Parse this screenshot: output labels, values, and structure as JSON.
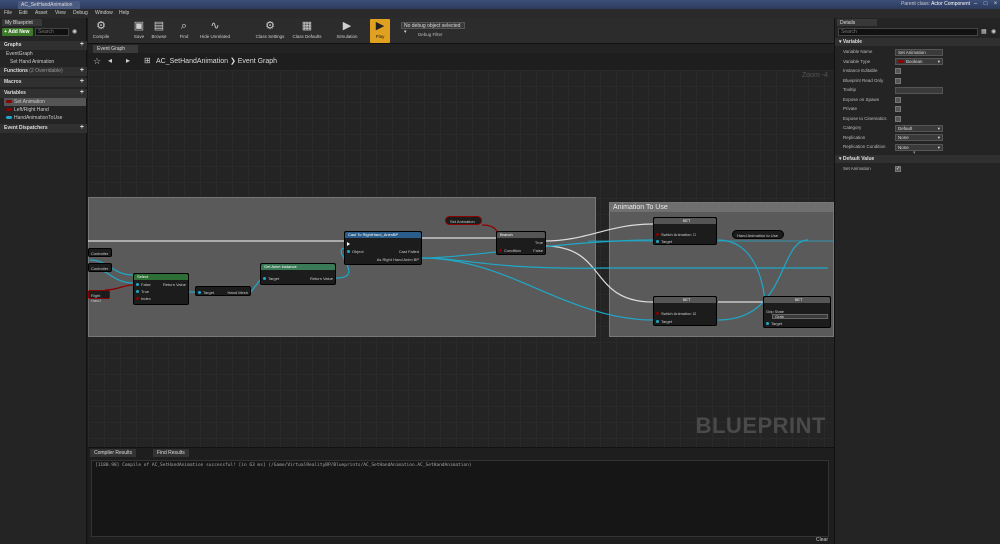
{
  "window": {
    "tab_title": "AC_SetHandAnimation",
    "top_right": "Parent class:",
    "parent_class": "Actor Component"
  },
  "menu": [
    "File",
    "Edit",
    "Asset",
    "View",
    "Debug",
    "Window",
    "Help"
  ],
  "left_panel": {
    "tab": "My Blueprint",
    "add_new": "+ Add New",
    "search_placeholder": "Search",
    "sections": {
      "graphs": "Graphs",
      "event_graph": "EventGraph",
      "event_item": "Set Hand Animation",
      "functions": "Functions",
      "functions_count": "(2 Overridable)",
      "macros": "Macros",
      "variables": "Variables",
      "dispatchers": "Event Dispatchers"
    },
    "variables": [
      {
        "name": "Set Animation",
        "color": "#8c0000"
      },
      {
        "name": "Left/Right Hand",
        "color": "#8c0000"
      },
      {
        "name": "HandAnimationToUse",
        "color": "#1fa8c8"
      }
    ]
  },
  "toolbar": {
    "buttons": [
      "Compile",
      "Save",
      "Browse",
      "Find",
      "Hide Unrelated",
      "Class Settings",
      "Class Defaults",
      "Simulation",
      "Play"
    ],
    "debug_select": "No debug object selected ▾",
    "debug_filter": "Debug Filter"
  },
  "graph": {
    "tab": "Event Graph",
    "breadcrumb_root": "AC_SetHandAnimation",
    "breadcrumb_leaf": "Event Graph",
    "zoom": "Zoom -4",
    "watermark": "BLUEPRINT",
    "comment2_title": "Animation To Use",
    "nodes": {
      "select": {
        "title": "Select",
        "pins": [
          "False",
          "True",
          "Index"
        ],
        "out": "Return Value"
      },
      "target_node": {
        "left": "Target",
        "right": "Hand Mesh"
      },
      "get_anim": {
        "title": "Get Anim Instance",
        "pins": [
          "Target"
        ],
        "out": "Return Value"
      },
      "cast": {
        "title": "Cast To RightHand_AnimBP",
        "pins": [
          "Object"
        ],
        "outs": [
          "Cast Failed",
          "As Right Hand Anim BP"
        ]
      },
      "set_anim_var": {
        "title": "Set Animation"
      },
      "branch": {
        "title": "Branch",
        "pins": [
          "Condition"
        ],
        "outs": [
          "True",
          "False"
        ]
      },
      "set1": {
        "title": "SET",
        "pins": [
          "Switch Animation",
          "Target"
        ]
      },
      "set2": {
        "title": "SET",
        "pins": [
          "Switch Animation",
          "Target"
        ]
      },
      "hand_anim_var": {
        "title": "Hand Animation to Use"
      },
      "set3": {
        "title": "SET",
        "pins": [
          "Grip State",
          "Target"
        ],
        "value": "Grab"
      },
      "left_frag1": "Controller",
      "left_frag2": "Controller",
      "left_frag3": "Right Hand"
    }
  },
  "bottom": {
    "tabs": [
      "Compiler Results",
      "Find Results"
    ],
    "log": "[1180.98] Compile of AC_SetHandAnimation successful! [in 63 ms] (/Game/VirtualRealityBP/Blueprints/AC_SetHandAnimation.AC_SetHandAnimation)",
    "clear": "Clear"
  },
  "details": {
    "tab": "Details",
    "search_placeholder": "Search",
    "variable_section": "Variable",
    "props": [
      {
        "label": "Variable Name",
        "value": "Set Animation",
        "type": "text"
      },
      {
        "label": "Variable Type",
        "value": "Boolean",
        "type": "select"
      },
      {
        "label": "Instance Editable",
        "type": "check",
        "checked": false
      },
      {
        "label": "Blueprint Read Only",
        "type": "check",
        "checked": false
      },
      {
        "label": "Tooltip",
        "value": "",
        "type": "text"
      },
      {
        "label": "Expose on Spawn",
        "type": "check",
        "checked": false
      },
      {
        "label": "Private",
        "type": "check",
        "checked": false
      },
      {
        "label": "Expose to Cinematics",
        "type": "check",
        "checked": false
      },
      {
        "label": "Category",
        "value": "Default",
        "type": "select"
      },
      {
        "label": "Replication",
        "value": "None",
        "type": "select"
      },
      {
        "label": "Replication Condition",
        "value": "None",
        "type": "select"
      }
    ],
    "default_section": "Default Value",
    "default_label": "Set Animation",
    "default_checked": true
  }
}
